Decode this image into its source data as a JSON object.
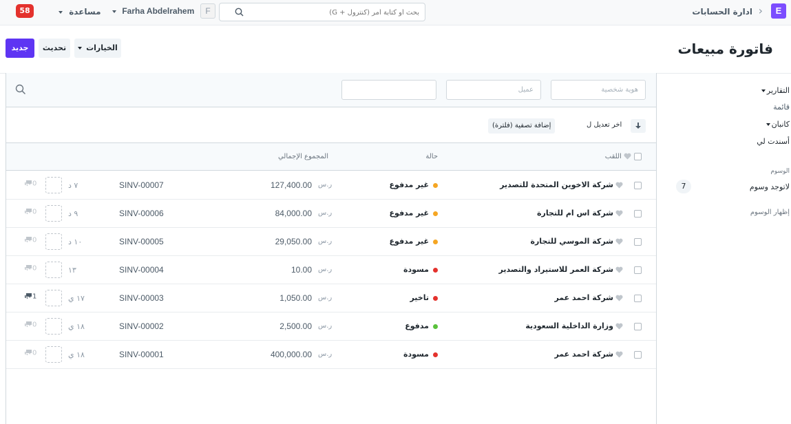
{
  "navbar": {
    "notifications": "58",
    "help_label": "مساعدة",
    "user_name": "Farha Abdelrahem",
    "user_initial": "F",
    "search_placeholder": "بحث أو كتابة أمر (كنترول + G)",
    "breadcrumb": "ادارة الحسابات",
    "app_initial": "E"
  },
  "page": {
    "title": "فاتورة مبيعات",
    "new_button": "جديد",
    "refresh_button": "تحديث",
    "options_button": "الخيارات"
  },
  "filters": {
    "id_placeholder": "هوية شخصية",
    "customer_placeholder": "عميل",
    "third_placeholder": ""
  },
  "sort": {
    "add_filter": "إضافة تصفية (فلترة)",
    "sort_label": "اخر تعديل ل"
  },
  "columns": {
    "title": "اللقب",
    "status": "حالة",
    "total": "المجموع الإجمالي"
  },
  "currency": "ر.س",
  "status_colors": {
    "paid": "#59c13b",
    "unpaid": "#f5a623",
    "draft": "#e4322d",
    "overdue": "#e4322d"
  },
  "rows": [
    {
      "title": "شركة الاخوين المتحدة للتصدير",
      "status": "غير مدفوع",
      "status_color": "#f5a623",
      "amount": "127,400.00",
      "name": "SINV-00007",
      "time": "٧ د",
      "comments": "0"
    },
    {
      "title": "شركة اس ام للتجارة",
      "status": "غير مدفوع",
      "status_color": "#f5a623",
      "amount": "84,000.00",
      "name": "SINV-00006",
      "time": "٩ د",
      "comments": "0"
    },
    {
      "title": "شركة الموسي للتجارة",
      "status": "غير مدفوع",
      "status_color": "#f5a623",
      "amount": "29,050.00",
      "name": "SINV-00005",
      "time": "١٠ د",
      "comments": "0"
    },
    {
      "title": "شركة العمر للاستيراد والتصدير",
      "status": "مسودة",
      "status_color": "#e4322d",
      "amount": "10.00",
      "name": "SINV-00004",
      "time": "١٣",
      "comments": "0"
    },
    {
      "title": "شركة احمد عمر",
      "status": "تاخير",
      "status_color": "#e4322d",
      "amount": "1,050.00",
      "name": "SINV-00003",
      "time": "١٧ ي",
      "comments": "1"
    },
    {
      "title": "وزارة الداخلية السعودية",
      "status": "مدفوع",
      "status_color": "#59c13b",
      "amount": "2,500.00",
      "name": "SINV-00002",
      "time": "١٨ ي",
      "comments": "0"
    },
    {
      "title": "شركة احمد عمر",
      "status": "مسودة",
      "status_color": "#e4322d",
      "amount": "400,000.00",
      "name": "SINV-00001",
      "time": "١٨ ي",
      "comments": "0"
    }
  ],
  "sidebar": {
    "reports": "التقارير",
    "list": "قائمة",
    "kanban": "كانبان",
    "assigned_to_me": "أسندت لي",
    "tags_label": "الوسوم",
    "no_tags": "لاتوجد وسوم",
    "no_tags_count": "7",
    "show_tags": "إظهار الوسوم"
  }
}
